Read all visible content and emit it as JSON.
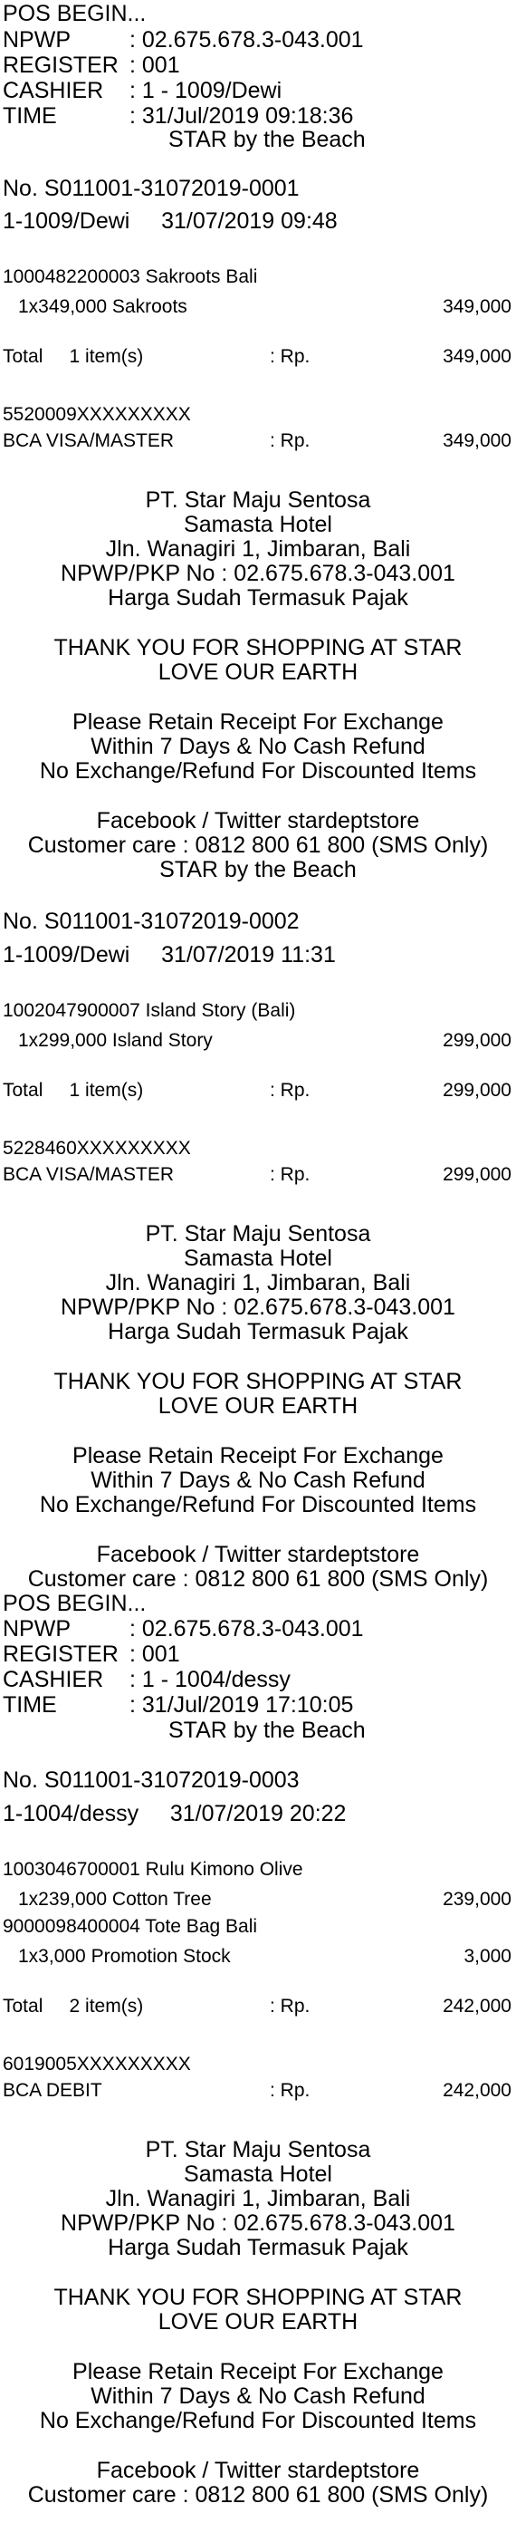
{
  "r1": {
    "header": {
      "pos_begin": "POS BEGIN...",
      "npwp_label": "NPWP",
      "npwp_value": ": 02.675.678.3-043.001",
      "register_label": "REGISTER",
      "register_value": ": 001",
      "cashier_label": "CASHIER",
      "cashier_value": ": 1 - 1009/Dewi",
      "time_label": "TIME",
      "time_value": ": 31/Jul/2019 09:18:36",
      "store": "STAR by the Beach"
    },
    "txn_no": "No. S011001-31072019-0001",
    "cashier_line": "1-1009/Dewi     31/07/2019 09:48",
    "items": [
      {
        "code": "1000482200003 Sakroots Bali",
        "desc": "1x349,000 Sakroots",
        "amount": "349,000"
      }
    ],
    "total_label": "Total     1 item(s)",
    "total_currency": ": Rp.",
    "total_amount": "349,000",
    "card_number": "5520009XXXXXXXXX",
    "payment_method": "BCA VISA/MASTER",
    "payment_currency": ": Rp.",
    "payment_amount": "349,000"
  },
  "r2": {
    "store": "STAR by the Beach",
    "txn_no": "No. S011001-31072019-0002",
    "cashier_line": "1-1009/Dewi     31/07/2019 11:31",
    "items": [
      {
        "code": "1002047900007 Island Story (Bali)",
        "desc": "1x299,000 Island Story",
        "amount": "299,000"
      }
    ],
    "total_label": "Total     1 item(s)",
    "total_currency": ": Rp.",
    "total_amount": "299,000",
    "card_number": "5228460XXXXXXXXX",
    "payment_method": "BCA VISA/MASTER",
    "payment_currency": ": Rp.",
    "payment_amount": "299,000"
  },
  "r3": {
    "header": {
      "pos_begin": "POS BEGIN...",
      "npwp_label": "NPWP",
      "npwp_value": ": 02.675.678.3-043.001",
      "register_label": "REGISTER",
      "register_value": ": 001",
      "cashier_label": "CASHIER",
      "cashier_value": ": 1 - 1004/dessy",
      "time_label": "TIME",
      "time_value": ": 31/Jul/2019 17:10:05",
      "store": "STAR by the Beach"
    },
    "txn_no": "No. S011001-31072019-0003",
    "cashier_line": "1-1004/dessy     31/07/2019 20:22",
    "items": [
      {
        "code": "1003046700001 Rulu Kimono Olive",
        "desc": "1x239,000 Cotton Tree",
        "amount": "239,000"
      },
      {
        "code": "9000098400004 Tote Bag Bali",
        "desc": "1x3,000 Promotion Stock",
        "amount": "3,000"
      }
    ],
    "total_label": "Total     2 item(s)",
    "total_currency": ": Rp.",
    "total_amount": "242,000",
    "card_number": "6019005XXXXXXXXX",
    "payment_method": "BCA DEBIT",
    "payment_currency": ": Rp.",
    "payment_amount": "242,000"
  },
  "footer": {
    "company": "PT. Star Maju Sentosa",
    "location": "Samasta Hotel",
    "address": "Jln. Wanagiri 1, Jimbaran, Bali",
    "npwp_pkp": "NPWP/PKP No : 02.675.678.3-043.001",
    "tax_note": "Harga Sudah Termasuk Pajak",
    "thanks": "THANK YOU FOR SHOPPING AT STAR",
    "earth": "LOVE OUR EARTH",
    "retain": "Please Retain Receipt For Exchange",
    "within": "Within 7 Days & No Cash Refund",
    "no_refund": "No Exchange/Refund For Discounted Items",
    "social": "Facebook / Twitter stardeptstore",
    "care": "Customer care : 0812 800 61 800 (SMS Only)"
  }
}
